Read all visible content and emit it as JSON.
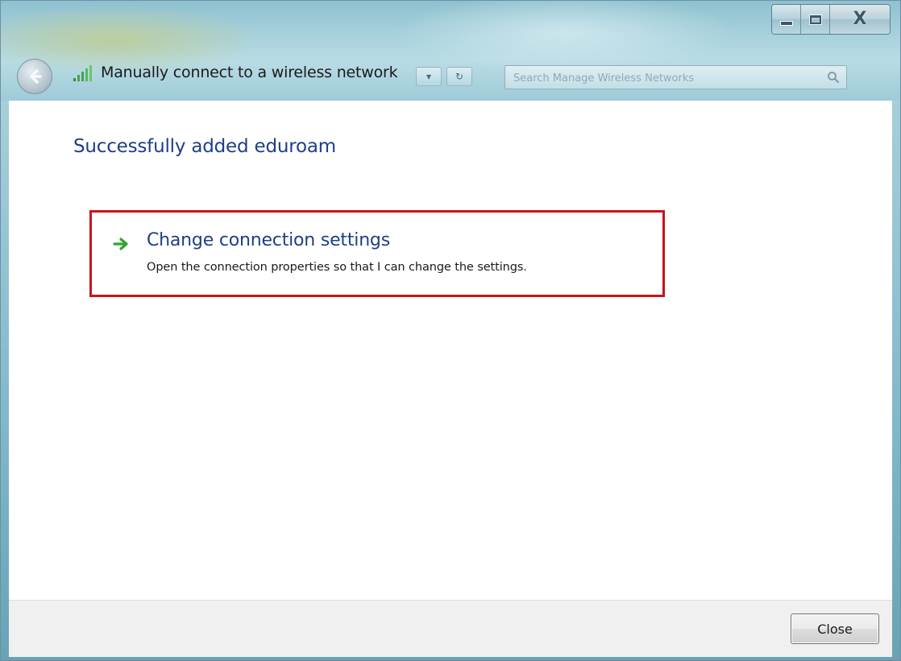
{
  "window": {
    "title": "Manually connect to a wireless network",
    "caption_buttons": {
      "minimize_icon": "minimize-icon",
      "maximize_icon": "maximize-icon",
      "close_glyph": "X"
    }
  },
  "navigation": {
    "back_icon": "back-arrow-icon",
    "network_icon": "wireless-signal-icon",
    "search": {
      "placeholder": "Search Manage Wireless Networks",
      "icon": "search-icon"
    }
  },
  "content": {
    "heading": "Successfully added eduroam",
    "command_link": {
      "title": "Change connection settings",
      "description": "Open the connection properties so that I can change the settings.",
      "icon": "green-arrow-icon"
    }
  },
  "footer": {
    "close_label": "Close"
  },
  "colors": {
    "heading": "#1e3e8a",
    "highlight_border": "#c4161c",
    "arrow": "#2fa52f",
    "footer_bg": "#f0f0f0"
  }
}
